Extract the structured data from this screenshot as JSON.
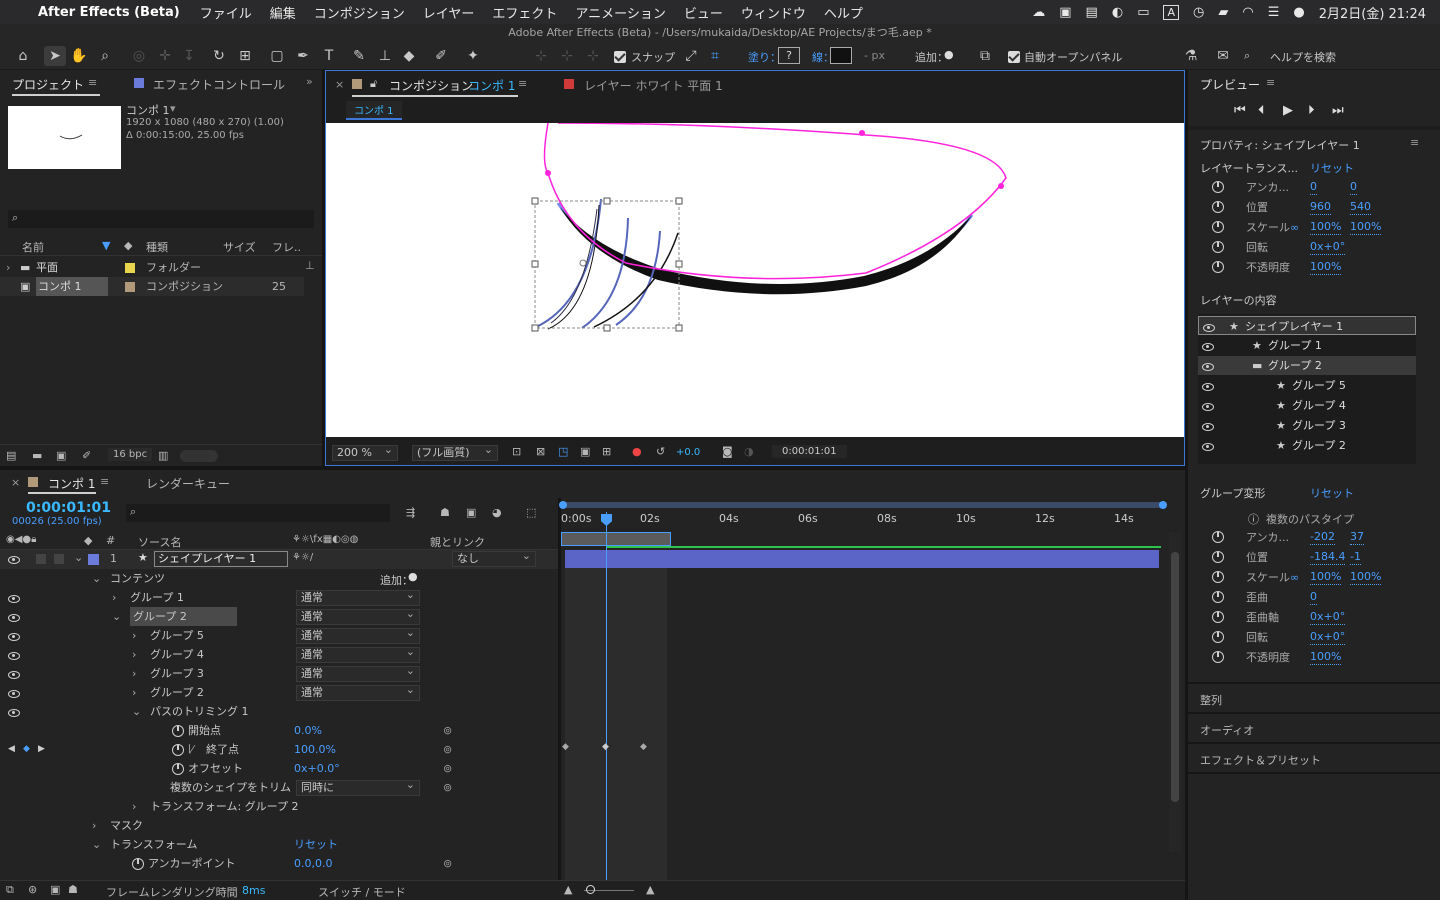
{
  "menubar": {
    "app_name": "After Effects (Beta)",
    "items": [
      "ファイル",
      "編集",
      "コンポジション",
      "レイヤー",
      "エフェクト",
      "アニメーション",
      "ビュー",
      "ウィンドウ",
      "ヘルプ"
    ],
    "date_time": "2月2日(金) 21:24",
    "input_indicator": "A"
  },
  "window": {
    "title": "Adobe After Effects (Beta) - /Users/mukaida/Desktop/AE Projects/まつ毛.aep *"
  },
  "toolbar": {
    "snap_label": "スナップ",
    "fill_label": "塗り：",
    "fill_value": "?",
    "stroke_label": "線：",
    "stroke_width": "- px",
    "add_label": "追加：",
    "auto_open_label": "自動オープンパネル",
    "help_search": "ヘルプを検索"
  },
  "project_panel": {
    "tab_project": "プロジェクト",
    "tab_effects": "エフェクトコントロール",
    "comp_name": "コンポ 1",
    "comp_dims": "1920 x 1080  (480 x 270) (1.00)",
    "comp_duration": "Δ 0:00:15:00, 25.00 fps",
    "col_name": "名前",
    "col_type": "種類",
    "col_size": "サイズ",
    "col_frame": "フレ..",
    "items": [
      {
        "name": "平面",
        "type": "フォルダー",
        "size": "",
        "color": "#e8d44d"
      },
      {
        "name": "コンポ 1",
        "type": "コンポジション",
        "size": "25",
        "color": "#b09a7a"
      }
    ],
    "bpc": "16 bpc"
  },
  "comp_panel": {
    "tab_label": "コンポジション",
    "tab_comp": "コンポ 1",
    "tab_layer": "レイヤー ホワイト 平面 1",
    "sub_tab": "コンポ 1",
    "zoom": "200 %",
    "quality": "(フル画質)",
    "exposure": "+0.0",
    "timecode": "0:00:01:01"
  },
  "preview_panel": {
    "title": "プレビュー"
  },
  "properties_panel": {
    "title": "プロパティ: シェイプレイヤー 1",
    "layer_transform": "レイヤートランス...",
    "reset": "リセット",
    "rows": [
      {
        "label": "アンカ...",
        "v1": "0",
        "v2": "0"
      },
      {
        "label": "位置",
        "v1": "960",
        "v2": "540"
      },
      {
        "label": "スケール",
        "v1": "100%",
        "v2": "100%"
      },
      {
        "label": "回転",
        "v1": "0x+0°",
        "v2": ""
      },
      {
        "label": "不透明度",
        "v1": "100%",
        "v2": ""
      }
    ],
    "contents_title": "レイヤーの内容",
    "contents": [
      {
        "label": "シェイプレイヤー 1",
        "indent": 0,
        "icon": "star"
      },
      {
        "label": "グループ 1",
        "indent": 1,
        "icon": "star"
      },
      {
        "label": "グループ 2",
        "indent": 1,
        "icon": "folder"
      },
      {
        "label": "グループ 5",
        "indent": 2,
        "icon": "star"
      },
      {
        "label": "グループ 4",
        "indent": 2,
        "icon": "star"
      },
      {
        "label": "グループ 3",
        "indent": 2,
        "icon": "star"
      },
      {
        "label": "グループ 2",
        "indent": 2,
        "icon": "star"
      }
    ],
    "group_transform": "グループ変形",
    "multi_path": "複数のパスタイプ",
    "group_rows": [
      {
        "label": "アンカ...",
        "v1": "-202",
        "v2": "37"
      },
      {
        "label": "位置",
        "v1": "-184.4",
        "v2": "-1"
      },
      {
        "label": "スケール",
        "v1": "100%",
        "v2": "100%"
      },
      {
        "label": "歪曲",
        "v1": "0",
        "v2": ""
      },
      {
        "label": "歪曲軸",
        "v1": "0x+0°",
        "v2": ""
      },
      {
        "label": "回転",
        "v1": "0x+0°",
        "v2": ""
      },
      {
        "label": "不透明度",
        "v1": "100%",
        "v2": ""
      }
    ],
    "align": "整列",
    "audio": "オーディオ",
    "effects_presets": "エフェクト＆プリセット"
  },
  "timeline": {
    "tab_comp": "コンポ 1",
    "tab_render": "レンダーキュー",
    "timecode": "0:00:01:01",
    "frame_info": "00026 (25.00 fps)",
    "col_source": "ソース名",
    "col_parent": "親とリンク",
    "layer_name": "シェイプレイヤー 1",
    "layer_num": "1",
    "parent_none": "なし",
    "add_label": "追加：",
    "rows": [
      {
        "label": "コンテンツ",
        "indent": 0,
        "arrow": "v",
        "eye": false,
        "mode": "",
        "value": ""
      },
      {
        "label": "グループ 1",
        "indent": 1,
        "arrow": ">",
        "eye": true,
        "mode": "通常",
        "value": ""
      },
      {
        "label": "グループ 2",
        "indent": 1,
        "arrow": "v",
        "eye": true,
        "mode": "通常",
        "value": "",
        "hl": true
      },
      {
        "label": "グループ 5",
        "indent": 2,
        "arrow": ">",
        "eye": true,
        "mode": "通常",
        "value": ""
      },
      {
        "label": "グループ 4",
        "indent": 2,
        "arrow": ">",
        "eye": true,
        "mode": "通常",
        "value": ""
      },
      {
        "label": "グループ 3",
        "indent": 2,
        "arrow": ">",
        "eye": true,
        "mode": "通常",
        "value": ""
      },
      {
        "label": "グループ 2",
        "indent": 2,
        "arrow": ">",
        "eye": true,
        "mode": "通常",
        "value": ""
      },
      {
        "label": "パスのトリミング 1",
        "indent": 2,
        "arrow": "v",
        "eye": true,
        "mode": "",
        "value": ""
      },
      {
        "label": "開始点",
        "indent": 3,
        "arrow": "",
        "eye": false,
        "mode": "",
        "value": "0.0%",
        "stopwatch": true
      },
      {
        "label": "終了点",
        "indent": 3,
        "arrow": "",
        "eye": false,
        "mode": "",
        "value": "100.0%",
        "stopwatch": true,
        "keyed": true
      },
      {
        "label": "オフセット",
        "indent": 3,
        "arrow": "",
        "eye": false,
        "mode": "",
        "value": "0x+0.0°",
        "stopwatch": true
      },
      {
        "label": "複数のシェイプをトリム",
        "indent": 3,
        "arrow": "",
        "eye": false,
        "mode": "同時に",
        "value": ""
      },
      {
        "label": "トランスフォーム: グループ 2",
        "indent": 2,
        "arrow": ">",
        "eye": false,
        "mode": "",
        "value": ""
      },
      {
        "label": "マスク",
        "indent": 0,
        "arrow": ">",
        "eye": false,
        "mode": "",
        "value": ""
      },
      {
        "label": "トランスフォーム",
        "indent": 0,
        "arrow": "v",
        "eye": false,
        "mode": "",
        "value": "リセット"
      },
      {
        "label": "アンカーポイント",
        "indent": 1,
        "arrow": "",
        "eye": false,
        "mode": "",
        "value": "0.0,0.0",
        "stopwatch": true
      }
    ],
    "ruler": [
      "0:00s",
      "02s",
      "04s",
      "06s",
      "08s",
      "10s",
      "12s",
      "14s"
    ],
    "render_time_label": "フレームレンダリング時間",
    "render_time": "8ms",
    "switch_mode": "スイッチ / モード"
  }
}
